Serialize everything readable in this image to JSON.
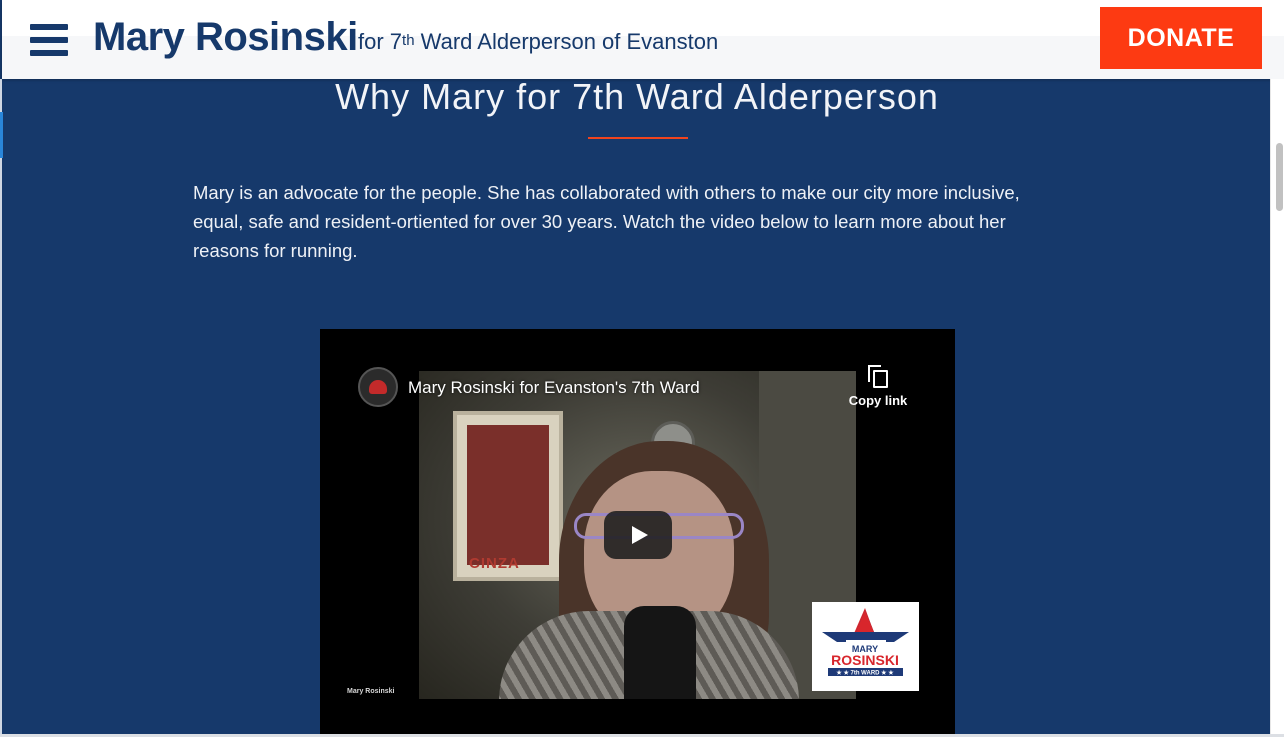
{
  "header": {
    "site_name": "Mary Rosinski",
    "subtitle_pre": "for 7",
    "subtitle_sup": "th",
    "subtitle_post": " Ward Alderperson of Evanston",
    "donate_label": "DONATE"
  },
  "main": {
    "title": "Why Mary for 7th Ward Alderperson",
    "intro": "Mary is an advocate for the people. She has collaborated with others to make our city more inclusive, equal, safe and resident-ortiented for over 30 years. Watch the video below to learn more about her reasons for running."
  },
  "video": {
    "title": "Mary Rosinski for Evanston's 7th Ward",
    "copy_link_label": "Copy link",
    "watermark": "Mary Rosinski",
    "poster_text": "CINZA",
    "logo_line1": "MARY",
    "logo_line2": "ROSINSKI",
    "logo_line3": "★ ★ 7th WARD ★ ★"
  },
  "colors": {
    "navy": "#16396b",
    "accent_orange": "#fd3a12",
    "rule_red": "#f0441e"
  },
  "icons": [
    "menu-icon",
    "copy-icon",
    "play-icon"
  ]
}
